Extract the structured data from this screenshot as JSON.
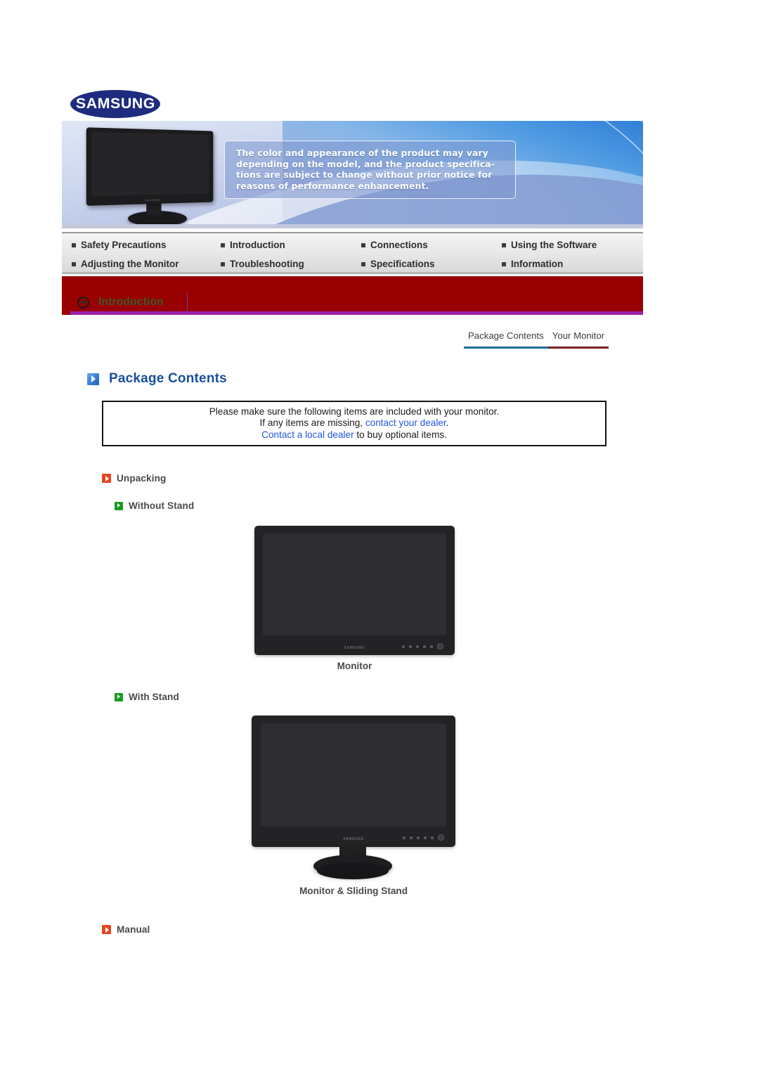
{
  "brand": {
    "logo_text": "SAMSUNG"
  },
  "hero": {
    "notice_line1": "The color and appearance of the product may vary",
    "notice_line2": "depending on the model, and the product specifica-",
    "notice_line3": "tions are subject to change without prior notice for",
    "notice_line4": "reasons of performance enhancement.",
    "monitor_brand": "SAMSUNG"
  },
  "nav": {
    "items": [
      {
        "label": "Safety Precautions"
      },
      {
        "label": "Introduction"
      },
      {
        "label": "Connections"
      },
      {
        "label": "Using the Software"
      },
      {
        "label": "Adjusting the Monitor"
      },
      {
        "label": "Troubleshooting"
      },
      {
        "label": "Specifications"
      },
      {
        "label": "Information"
      }
    ]
  },
  "section_header": {
    "title": "Introduction"
  },
  "tabs": [
    {
      "label": "Package Contents",
      "state": "active",
      "underline_color": "#1f6f9c"
    },
    {
      "label": "Your Monitor",
      "state": "inactive",
      "underline_color": "#7b2222"
    }
  ],
  "page": {
    "heading": "Package Contents"
  },
  "notice": {
    "line1": "Please make sure the following items are included with your monitor.",
    "line2_prefix": "If any items are missing, ",
    "line2_link": "contact your dealer",
    "line2_suffix": ".",
    "line3_link": "Contact a local dealer",
    "line3_suffix": " to buy optional items."
  },
  "sections": {
    "unpacking": "Unpacking",
    "without_stand": "Without Stand",
    "with_stand": "With Stand",
    "manual": "Manual"
  },
  "captions": {
    "monitor": "Monitor",
    "monitor_sliding_stand": "Monitor & Sliding Stand"
  },
  "product_images": {
    "monitor_brand": "SAMSUNG"
  },
  "colors": {
    "brand_blue": "#1d2c7e",
    "heading_blue": "#1a4f9c",
    "section_red": "#990000",
    "purple_rule": "#9b22b0",
    "link_blue": "#2255dd",
    "accent_orange": "#e8451f",
    "accent_green": "#1a9b22"
  }
}
